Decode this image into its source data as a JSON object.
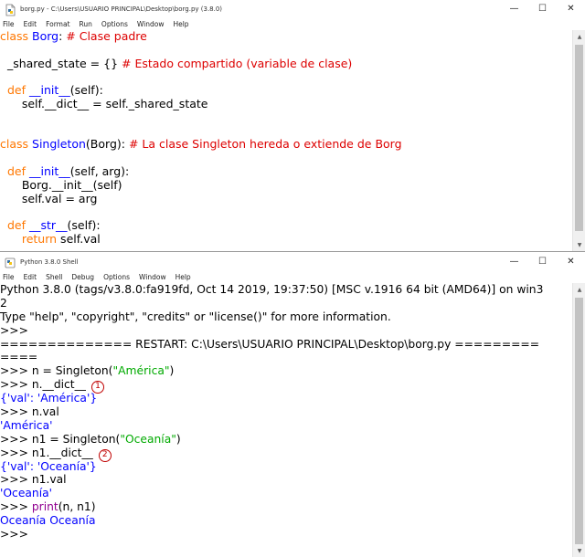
{
  "editor": {
    "title": "borg.py - C:\\Users\\USUARIO PRINCIPAL\\Desktop\\borg.py (3.8.0)",
    "menu": [
      "File",
      "Edit",
      "Format",
      "Run",
      "Options",
      "Window",
      "Help"
    ],
    "code": {
      "l1": {
        "kw": "class",
        "name": "Borg",
        "rest": ": ",
        "comment": "# Clase padre"
      },
      "l3": {
        "text": "  _shared_state = {} ",
        "comment": "# Estado compartido (variable de clase)"
      },
      "l5": {
        "indent": "  ",
        "kw": "def",
        "name": "__init__",
        "rest": "(self):"
      },
      "l6": {
        "text": "      self.__dict__ = self._shared_state"
      },
      "l9": {
        "kw": "class",
        "name": "Singleton",
        "rest": "(Borg): ",
        "comment": "# La clase Singleton hereda o extiende de Borg"
      },
      "l11": {
        "indent": "  ",
        "kw": "def",
        "name": "__init__",
        "rest": "(self, arg):"
      },
      "l12": {
        "text": "      Borg.__init__(self)"
      },
      "l13": {
        "text": "      self.val = arg"
      },
      "l15": {
        "indent": "  ",
        "kw": "def",
        "name": "__str__",
        "rest": "(self):"
      },
      "l16": {
        "indent": "      ",
        "kw": "return",
        "rest": " self.val"
      }
    }
  },
  "shell": {
    "title": "Python 3.8.0 Shell",
    "menu": [
      "File",
      "Edit",
      "Shell",
      "Debug",
      "Options",
      "Window",
      "Help"
    ],
    "banner1": "Python 3.8.0 (tags/v3.8.0:fa919fd, Oct 14 2019, 19:37:50) [MSC v.1916 64 bit (AMD64)] on win3",
    "banner2": "2",
    "banner3": "Type \"help\", \"copyright\", \"credits\" or \"license()\" for more information.",
    "prompt": ">>> ",
    "restart1": "============== RESTART: C:\\Users\\USUARIO PRINCIPAL\\Desktop\\borg.py =========",
    "restart2": "====",
    "cmd1_pre": "n = Singleton(",
    "cmd1_str": "\"América\"",
    "cmd1_post": ")",
    "cmd2": "n.__dict__",
    "marker1": "1",
    "out2": "{'val': 'América'}",
    "cmd3": "n.val",
    "out3": "'América'",
    "cmd4_pre": "n1 = Singleton(",
    "cmd4_str": "\"Oceanía\"",
    "cmd4_post": ")",
    "cmd5": "n1.__dict__",
    "marker2": "2",
    "out5": "{'val': 'Oceanía'}",
    "cmd6": "n1.val",
    "out6": "'Oceanía'",
    "cmd7_fn": "print",
    "cmd7_args": "(n, n1)",
    "out7": "Oceanía Oceanía"
  },
  "window_controls": {
    "minimize": "—",
    "maximize": "☐",
    "close": "✕"
  }
}
